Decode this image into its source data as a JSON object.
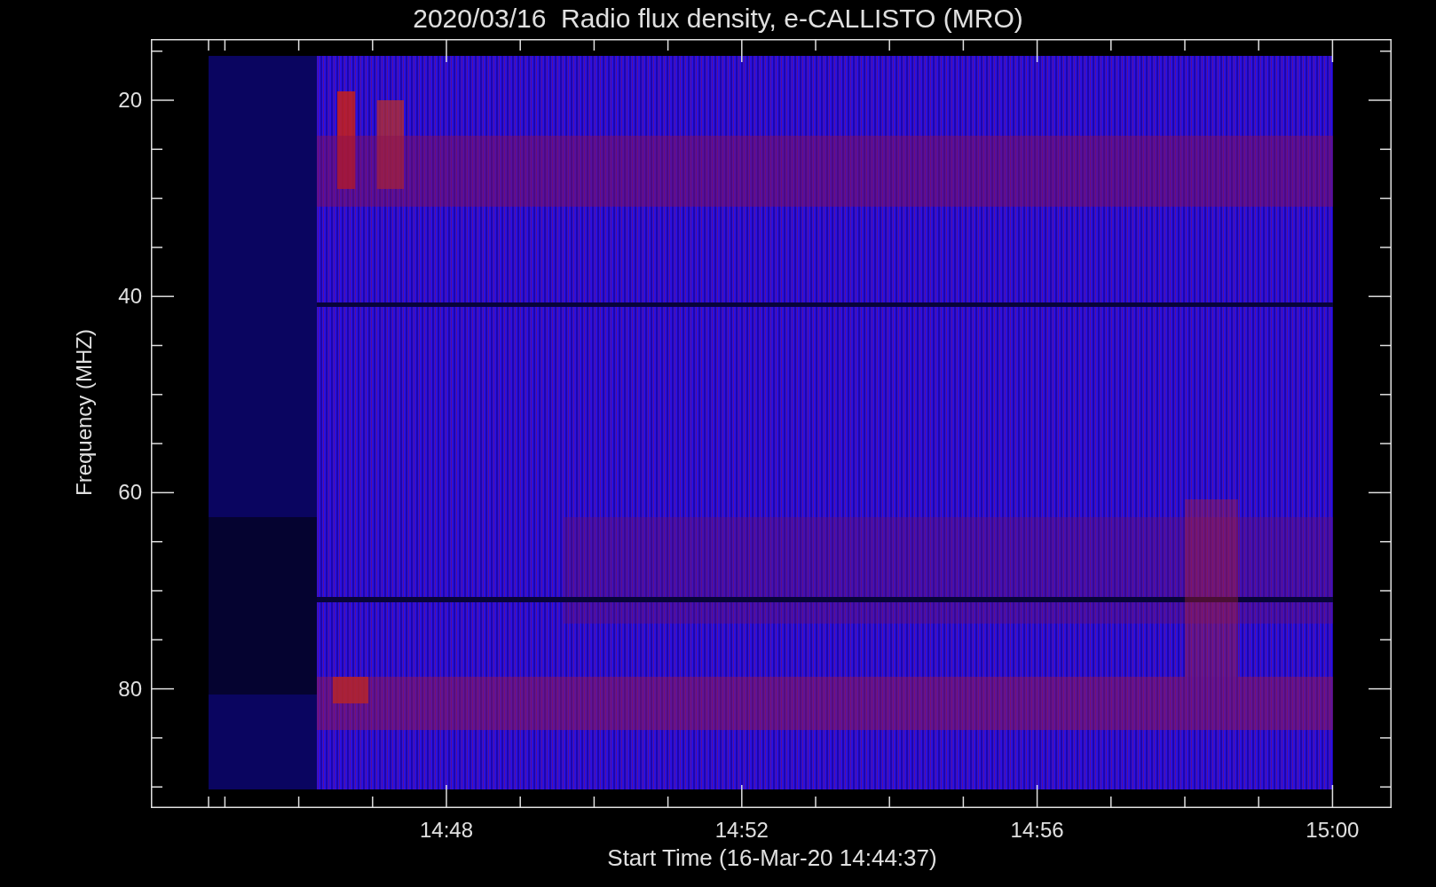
{
  "title": "2020/03/16  Radio flux density, e-CALLISTO (MRO)",
  "y_axis": {
    "label": "Frequency (MHZ)",
    "ticks": [
      "20",
      "40",
      "60",
      "80"
    ]
  },
  "x_axis": {
    "label": "Start Time (16-Mar-20 14:44:37)",
    "ticks": [
      "14:48",
      "14:52",
      "14:56",
      "15:00"
    ]
  }
}
